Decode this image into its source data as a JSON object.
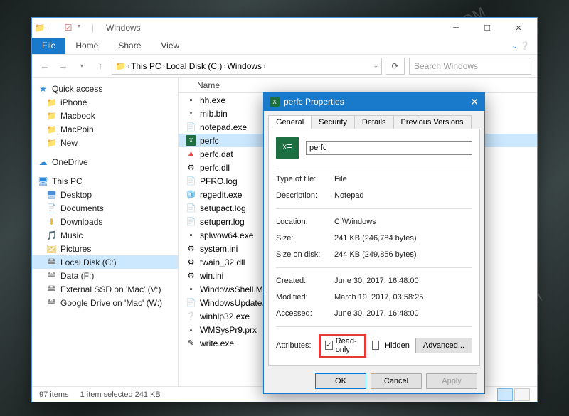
{
  "window": {
    "title": "Windows",
    "tabs": {
      "file": "File",
      "home": "Home",
      "share": "Share",
      "view": "View"
    },
    "breadcrumb": [
      "This PC",
      "Local Disk (C:)",
      "Windows"
    ],
    "search_placeholder": "Search Windows",
    "column_header": "Name",
    "status": {
      "items": "97 items",
      "selected": "1 item selected  241 KB"
    }
  },
  "nav": {
    "quick_access": "Quick access",
    "qa_items": [
      "iPhone",
      "Macbook",
      "MacPoin",
      "New"
    ],
    "onedrive": "OneDrive",
    "this_pc": "This PC",
    "pc_items": [
      "Desktop",
      "Documents",
      "Downloads",
      "Music",
      "Pictures",
      "Local Disk (C:)",
      "Data (F:)",
      "External SSD on 'Mac' (V:)",
      "Google Drive on 'Mac' (W:)"
    ]
  },
  "files": [
    {
      "name": "hh.exe",
      "icon": "app"
    },
    {
      "name": "mib.bin",
      "icon": "file"
    },
    {
      "name": "notepad.exe",
      "icon": "notepad"
    },
    {
      "name": "perfc",
      "icon": "excel",
      "selected": true
    },
    {
      "name": "perfc.dat",
      "icon": "vlc"
    },
    {
      "name": "perfc.dll",
      "icon": "dll"
    },
    {
      "name": "PFRO.log",
      "icon": "text"
    },
    {
      "name": "regedit.exe",
      "icon": "regedit"
    },
    {
      "name": "setupact.log",
      "icon": "text"
    },
    {
      "name": "setuperr.log",
      "icon": "text"
    },
    {
      "name": "splwow64.exe",
      "icon": "app"
    },
    {
      "name": "system.ini",
      "icon": "ini"
    },
    {
      "name": "twain_32.dll",
      "icon": "dll"
    },
    {
      "name": "win.ini",
      "icon": "ini"
    },
    {
      "name": "WindowsShell.Ma...",
      "icon": "file"
    },
    {
      "name": "WindowsUpdate....",
      "icon": "text"
    },
    {
      "name": "winhlp32.exe",
      "icon": "help"
    },
    {
      "name": "WMSysPr9.prx",
      "icon": "file"
    },
    {
      "name": "write.exe",
      "icon": "write"
    }
  ],
  "props": {
    "title": "perfc Properties",
    "tabs": [
      "General",
      "Security",
      "Details",
      "Previous Versions"
    ],
    "filename": "perfc",
    "labels": {
      "type": "Type of file:",
      "desc": "Description:",
      "loc": "Location:",
      "size": "Size:",
      "disk": "Size on disk:",
      "created": "Created:",
      "modified": "Modified:",
      "accessed": "Accessed:",
      "attrs": "Attributes:",
      "readonly": "Read-only",
      "hidden": "Hidden",
      "advanced": "Advanced..."
    },
    "values": {
      "type": "File",
      "desc": "Notepad",
      "loc": "C:\\Windows",
      "size": "241 KB (246,784 bytes)",
      "disk": "244 KB (249,856 bytes)",
      "created": "June 30, 2017, 16:48:00",
      "modified": "March 19, 2017, 03:58:25",
      "accessed": "June 30, 2017, 16:48:00"
    },
    "buttons": {
      "ok": "OK",
      "cancel": "Cancel",
      "apply": "Apply"
    }
  },
  "watermark": "WINPOIN.COM"
}
